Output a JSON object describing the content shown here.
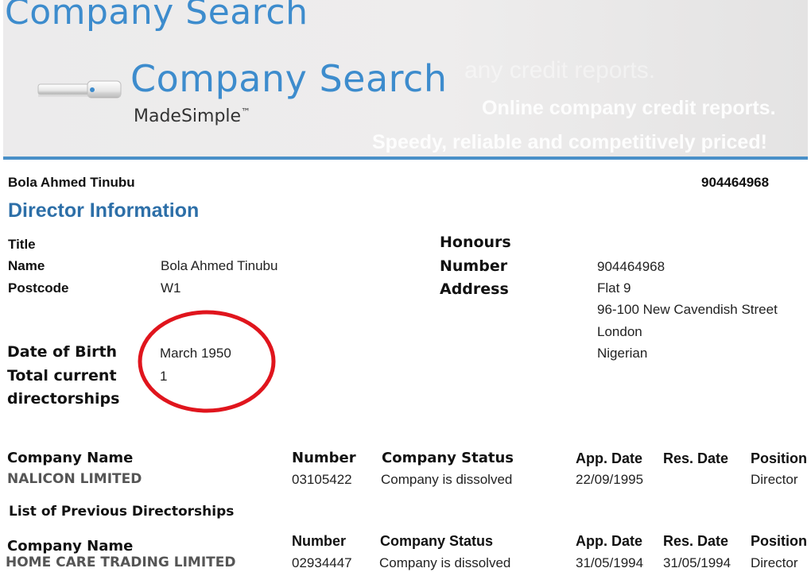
{
  "banner": {
    "top_title": "Company Search",
    "logo_title": "Company Search",
    "logo_subtitle": "MadeSimple",
    "logo_tm": "™",
    "ghost_text": "any credit reports.",
    "tagline_1": "Online company credit reports.",
    "tagline_2": "Speedy, reliable and competitively priced!",
    "accent_color": "#3d8ccd",
    "bar_color": "#4a90c8"
  },
  "header": {
    "name": "Bola Ahmed Tinubu",
    "number": "904464968"
  },
  "section_title": "Director Information",
  "details_left": {
    "title_label": "Title",
    "title_value": "",
    "name_label": "Name",
    "name_value": "Bola Ahmed Tinubu",
    "postcode_label": "Postcode",
    "postcode_value": "W1",
    "dob_label": "Date of Birth",
    "dob_value": "March 1950",
    "directorships_label_1": "Total current",
    "directorships_label_2": "directorships",
    "directorships_value": "1"
  },
  "details_right": {
    "honours_label": "Honours",
    "honours_value": "",
    "number_label": "Number",
    "number_value": "904464968",
    "address_label": "Address",
    "address_lines": [
      "Flat 9",
      "96-100 New Cavendish Street",
      "London"
    ],
    "nationality": "Nigerian"
  },
  "highlight_color": "#e0151d",
  "current_table": {
    "headers": {
      "company": "Company Name",
      "number": "Number",
      "status": "Company Status",
      "app_date": "App. Date",
      "res_date": "Res. Date",
      "position": "Position"
    },
    "rows": [
      {
        "company": "NALICON LIMITED",
        "number": "03105422",
        "status": "Company is dissolved",
        "app_date": "22/09/1995",
        "res_date": "",
        "position": "Director"
      }
    ]
  },
  "previous_title": "List of Previous Directorships",
  "previous_table": {
    "headers": {
      "company": "Company Name",
      "number": "Number",
      "status": "Company Status",
      "app_date": "App. Date",
      "res_date": "Res. Date",
      "position": "Position"
    },
    "rows": [
      {
        "company": "HOME CARE TRADING LIMITED",
        "number": "02934447",
        "status": "Company is dissolved",
        "app_date": "31/05/1994",
        "res_date": "31/05/1994",
        "position": "Director"
      }
    ]
  }
}
